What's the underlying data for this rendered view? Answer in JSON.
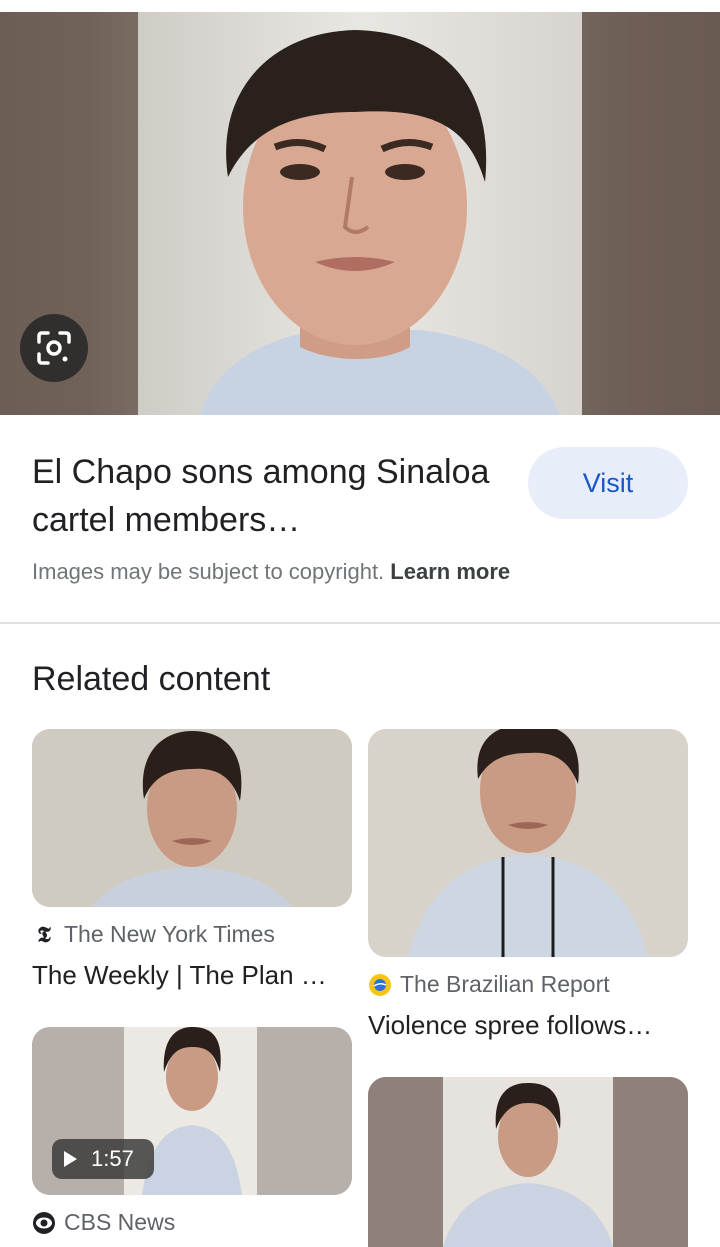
{
  "result": {
    "title": "El Chapo sons among Sinaloa cartel members…",
    "visit_label": "Visit",
    "copyright_text": "Images may be subject to copyright.",
    "learn_more": "Learn more"
  },
  "related": {
    "heading": "Related content",
    "items": [
      {
        "source": "The New York Times",
        "headline": "The Weekly | The Plan …",
        "icon": "nyt-logo-icon"
      },
      {
        "source": "The Brazilian Report",
        "headline": "Violence spree follows…",
        "icon": "brazilian-report-logo-icon"
      },
      {
        "source": "CBS News",
        "duration": "1:57",
        "icon": "cbs-eye-logo-icon"
      },
      {
        "icon": "photo"
      }
    ]
  }
}
